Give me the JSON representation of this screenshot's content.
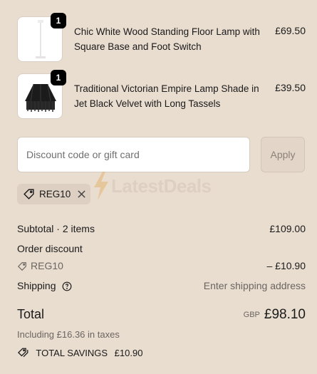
{
  "line_items": [
    {
      "title": "Chic White Wood Standing Floor Lamp with Square Base and Foot Switch",
      "price": "£69.50",
      "quantity": "1"
    },
    {
      "title": "Traditional Victorian Empire Lamp Shade in Jet Black Velvet with Long Tassels",
      "price": "£39.50",
      "quantity": "1"
    }
  ],
  "discount": {
    "placeholder": "Discount code or gift card",
    "apply_label": "Apply",
    "applied_code": "REG10"
  },
  "watermark": {
    "text": "LatestDeals"
  },
  "summary": {
    "subtotal_label": "Subtotal · 2 items",
    "subtotal_value": "£109.00",
    "order_discount_label": "Order discount",
    "discount_code": "REG10",
    "discount_value": "– £10.90",
    "shipping_label": "Shipping",
    "shipping_value": "Enter shipping address",
    "total_label": "Total",
    "currency": "GBP",
    "total_value": "£98.10",
    "taxes_note": "Including £16.36 in taxes",
    "savings_label": "TOTAL SAVINGS",
    "savings_value": "£10.90"
  },
  "icons": {
    "tag": "tag-icon",
    "close": "close-icon",
    "help": "help-circle-icon",
    "savings": "tags-icon"
  }
}
